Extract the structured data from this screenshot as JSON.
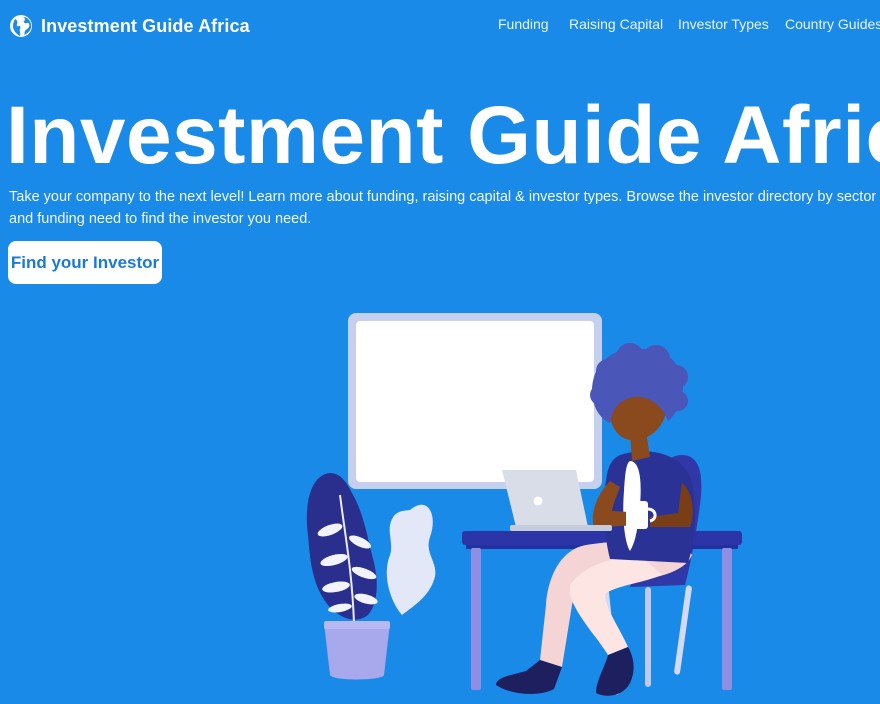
{
  "navbar": {
    "brand": {
      "name": "Investment Guide Africa",
      "icon": "globe-icon"
    },
    "links": [
      {
        "label": "Funding"
      },
      {
        "label": "Raising Capital"
      },
      {
        "label": "Investor Types"
      },
      {
        "label": "Country Guides"
      }
    ]
  },
  "hero": {
    "title": "Investment Guide Africa",
    "lede_line1": "Take your company to the next level! Learn more about funding, raising capital & investor types. Browse the investor directory by sector",
    "lede_line2": "and funding need to find the investor you need.",
    "cta_label": "Find your Investor"
  },
  "illustration": {
    "subject": "woman working on laptop at desk with whiteboard and potted plant"
  },
  "colors": {
    "background": "#1a8ae8",
    "text": "#ffffff",
    "cta_background": "#ffffff",
    "cta_text": "#1a7ad8"
  }
}
